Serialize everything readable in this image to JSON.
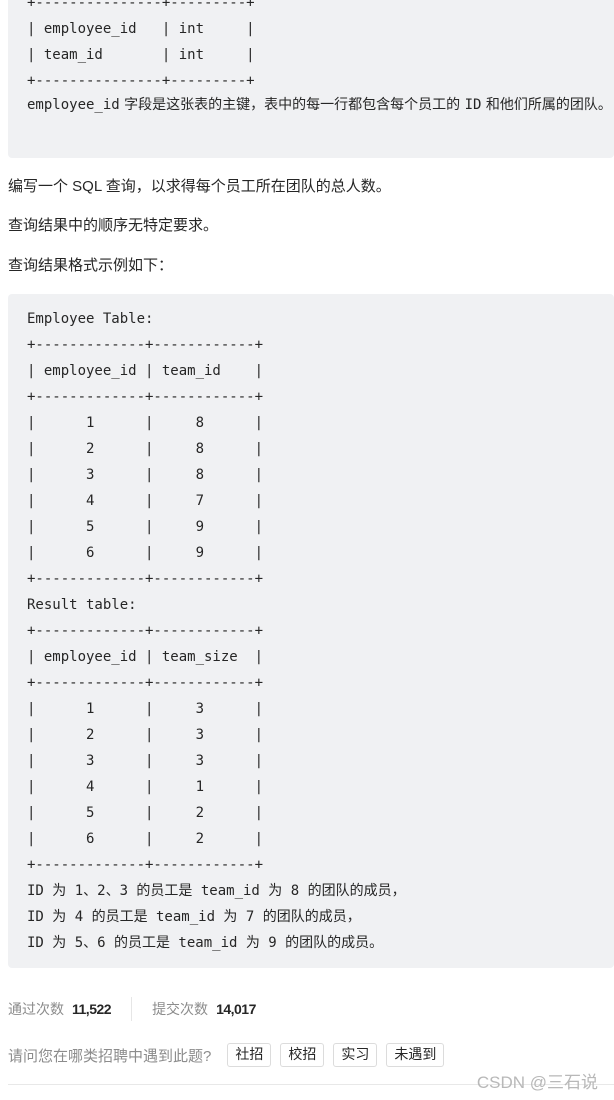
{
  "schema_block": {
    "lines": [
      "+---------------+---------+",
      "| employee_id   | int     |",
      "| team_id       | int     |",
      "+---------------+---------+"
    ],
    "desc_code": "employee_id",
    "desc_text": " 字段是这张表的主键，表中的每一行都包含每个员工的 ",
    "desc_code2": "ID",
    "desc_text2": " 和他们所属的团队。"
  },
  "paragraphs": [
    "编写一个 SQL 查询，以求得每个员工所在团队的总人数。",
    "查询结果中的顺序无特定要求。",
    "查询结果格式示例如下："
  ],
  "example": {
    "employee_table_title": "Employee Table:",
    "employee_table": {
      "columns": [
        "employee_id",
        "team_id"
      ],
      "rows": [
        [
          "1",
          "8"
        ],
        [
          "2",
          "8"
        ],
        [
          "3",
          "8"
        ],
        [
          "4",
          "7"
        ],
        [
          "5",
          "9"
        ],
        [
          "6",
          "9"
        ]
      ]
    },
    "result_table_title": "Result table:",
    "result_table": {
      "columns": [
        "employee_id",
        "team_size"
      ],
      "rows": [
        [
          "1",
          "3"
        ],
        [
          "2",
          "3"
        ],
        [
          "3",
          "3"
        ],
        [
          "4",
          "1"
        ],
        [
          "5",
          "2"
        ],
        [
          "6",
          "2"
        ]
      ]
    },
    "explanation": [
      "ID 为 1、2、3 的员工是 team_id 为 8 的团队的成员，",
      "ID 为 4 的员工是 team_id 为 7 的团队的成员，",
      "ID 为 5、6 的员工是 team_id 为 9 的团队的成员。"
    ]
  },
  "stats": {
    "accepted_label": "通过次数",
    "accepted_value": "11,522",
    "submissions_label": "提交次数",
    "submissions_value": "14,017"
  },
  "survey": {
    "question": "请问您在哪类招聘中遇到此题?",
    "options": [
      "社招",
      "校招",
      "实习",
      "未遇到"
    ]
  },
  "watermark": "CSDN @三石说"
}
